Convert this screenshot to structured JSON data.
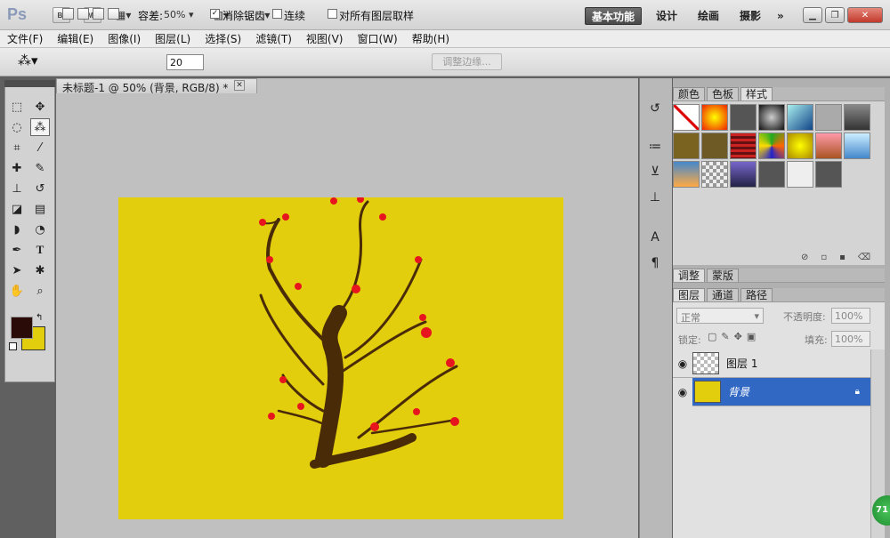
{
  "app": {
    "logo": "Ps",
    "bridge": "Br",
    "minibridge": "Mb",
    "zoom": "50%"
  },
  "workspaces": {
    "essentials": "基本功能",
    "design": "设计",
    "painting": "绘画",
    "photography": "摄影"
  },
  "menu": [
    "文件(F)",
    "编辑(E)",
    "图像(I)",
    "图层(L)",
    "选择(S)",
    "滤镜(T)",
    "视图(V)",
    "窗口(W)",
    "帮助(H)"
  ],
  "options": {
    "tolerance_label": "容差:",
    "tolerance_value": "20",
    "antialias": "消除锯齿",
    "contiguous": "连续",
    "sample_all": "对所有图层取样",
    "refine_edge": "调整边缘..."
  },
  "document": {
    "tab_title": "未标题-1 @ 50% (背景, RGB/8) *",
    "canvas_color": "#e2ce0d"
  },
  "panels": {
    "top_tabs": [
      "颜色",
      "色板",
      "样式"
    ],
    "adjust_tabs": [
      "调整",
      "蒙版"
    ],
    "layer_tabs": [
      "图层",
      "通道",
      "路径"
    ],
    "blend_mode": "正常",
    "opacity_label": "不透明度:",
    "opacity_value": "100%",
    "lock_label": "锁定:",
    "fill_label": "填充:",
    "fill_value": "100%"
  },
  "layers": [
    {
      "name": "图层 1"
    },
    {
      "name": "背景"
    }
  ],
  "colors": {
    "foreground": "#2b0b08",
    "background": "#e2ce0d",
    "selected_layer": "#3168c4"
  },
  "badge": "71"
}
